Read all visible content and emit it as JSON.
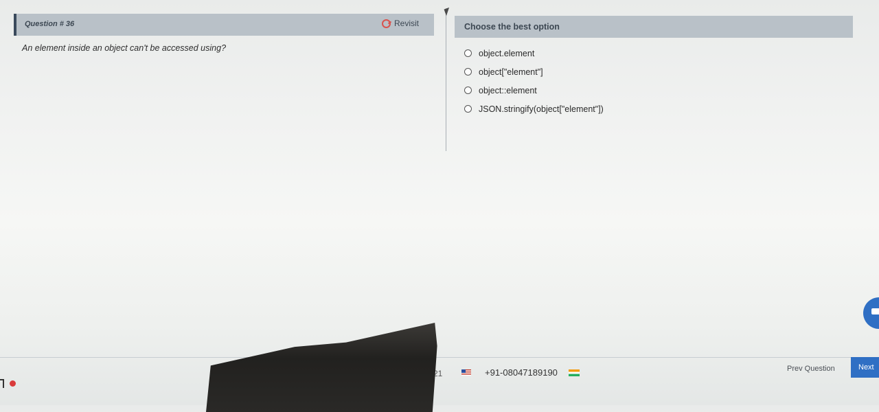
{
  "question": {
    "header_label": "Question # 36",
    "revisit_label": "Revisit",
    "revisit_icon": "revisit-icon",
    "text": "An element inside an object can't be accessed using?"
  },
  "options_panel": {
    "header_label": "Choose the best option",
    "options": [
      {
        "label": "object.element"
      },
      {
        "label": "object[\"element\"]"
      },
      {
        "label": "object::element"
      },
      {
        "label": "JSON.stringify(object[\"element\"])"
      }
    ]
  },
  "footer": {
    "partial_text": "21",
    "support_phone": "+91-08047189190",
    "prev_label": "Prev Question",
    "next_label": "Next"
  },
  "colors": {
    "header_bg": "#b9c1c8",
    "accent_blue": "#2f6fc4",
    "record_red": "#d93b3b"
  }
}
